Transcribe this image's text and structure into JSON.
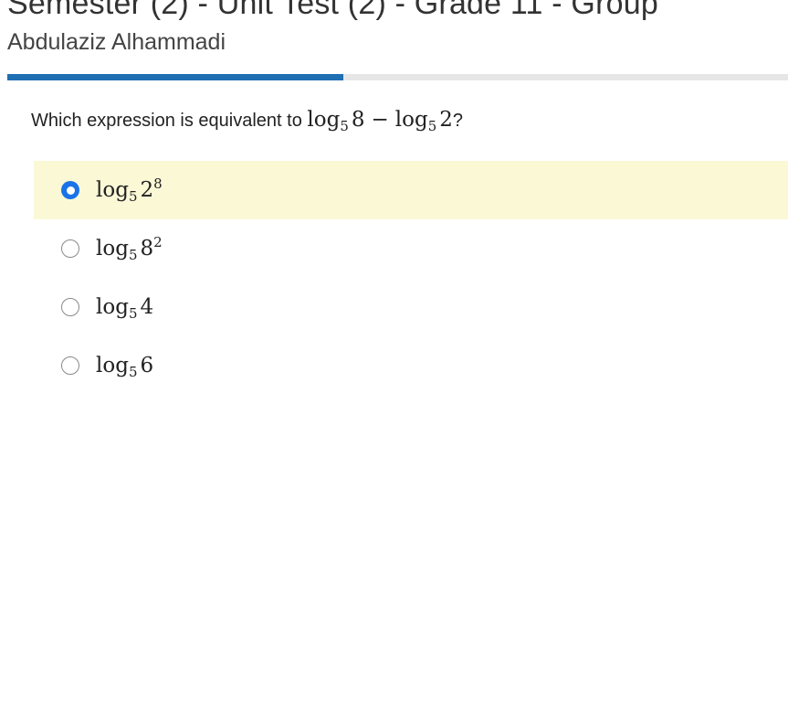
{
  "header": {
    "title": "Semester (2) - Unit Test (2) - Grade 11 - Group",
    "student_name": "Abdulaziz Alhammadi"
  },
  "progress": {
    "fraction": 0.43
  },
  "question": {
    "prompt": "Which expression is equivalent to",
    "expression": {
      "log1": "log",
      "base1": "5",
      "arg1": "8",
      "operator": "−",
      "log2": "log",
      "base2": "5",
      "arg2": "2"
    },
    "end": "?"
  },
  "options": [
    {
      "log": "log",
      "base": "5",
      "arg": "2",
      "exp": "8",
      "selected": true
    },
    {
      "log": "log",
      "base": "5",
      "arg": "8",
      "exp": "2",
      "selected": false
    },
    {
      "log": "log",
      "base": "5",
      "arg": "4",
      "exp": "",
      "selected": false
    },
    {
      "log": "log",
      "base": "5",
      "arg": "6",
      "exp": "",
      "selected": false
    }
  ],
  "colors": {
    "progress": "#1f6fb3",
    "selected_background": "#fbf8d6",
    "radio_checked": "#1a73e8"
  }
}
